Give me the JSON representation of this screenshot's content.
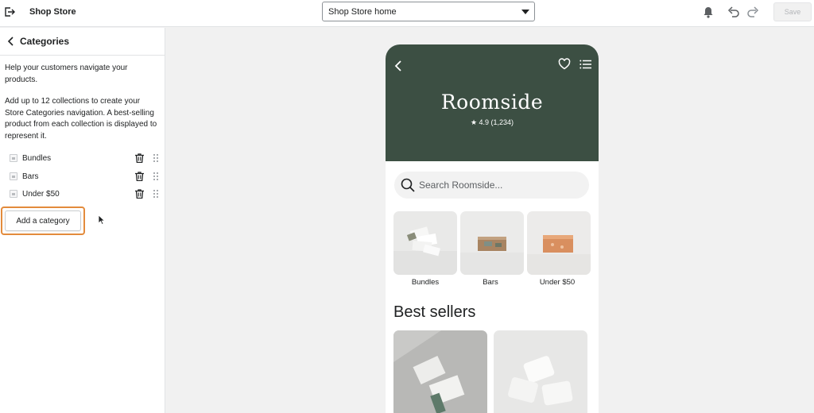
{
  "topbar": {
    "store_name": "Shop Store",
    "page_select": "Shop Store home",
    "save_label": "Save"
  },
  "sidebar": {
    "title": "Categories",
    "help_text": "Help your customers navigate your products.",
    "description": "Add up to 12 collections to create your Store Categories navigation. A best-selling product from each collection is displayed to represent it.",
    "categories": [
      {
        "label": "Bundles"
      },
      {
        "label": "Bars"
      },
      {
        "label": "Under $50"
      }
    ],
    "add_button_label": "Add a category"
  },
  "preview": {
    "shop_title": "Roomside",
    "rating": "★ 4.9 (1,234)",
    "search_placeholder": "Search Roomside...",
    "category_tiles": [
      {
        "label": "Bundles"
      },
      {
        "label": "Bars"
      },
      {
        "label": "Under $50"
      }
    ],
    "best_sellers_title": "Best sellers"
  },
  "colors": {
    "hero_bg": "#3c4f43",
    "highlight_outline": "#e38b3c"
  },
  "icons": [
    "exit-icon",
    "chevron-down-icon",
    "bell-icon",
    "undo-icon",
    "redo-icon",
    "back-chevron-icon",
    "trash-icon",
    "drag-handle-icon",
    "heart-icon",
    "menu-list-icon",
    "search-icon"
  ]
}
